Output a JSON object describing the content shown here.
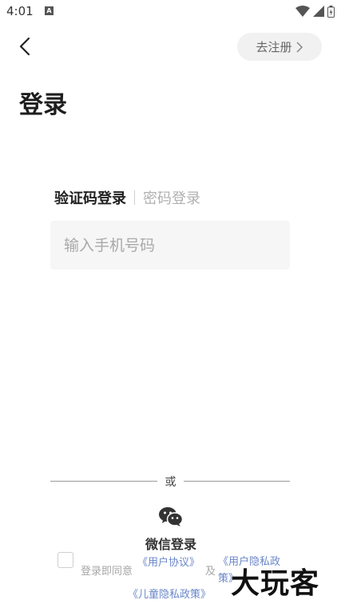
{
  "status_bar": {
    "time": "4:01",
    "notification_icon": "A"
  },
  "nav": {
    "register_label": "去注册"
  },
  "title": "登录",
  "tabs": {
    "active": "验证码登录",
    "inactive": "密码登录"
  },
  "phone_input": {
    "placeholder": "输入手机号码",
    "value": ""
  },
  "divider": {
    "text": "或"
  },
  "wechat": {
    "label": "微信登录"
  },
  "agreement": {
    "prefix": "登录即同意",
    "user_agreement": "《用户协议》",
    "and": "及",
    "privacy_policy": "《用户隐私政策》",
    "child_privacy": "《儿童隐私政策》"
  },
  "watermark": "大玩客",
  "colors": {
    "link": "#6a86c8",
    "input_bg": "#f6f6f6",
    "register_bg": "#f1f1f1"
  }
}
